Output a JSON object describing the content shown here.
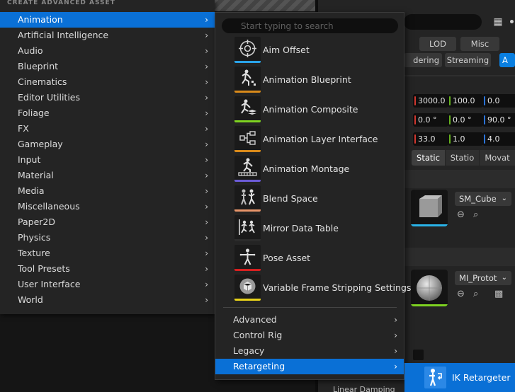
{
  "main_menu": {
    "header": "CREATE ADVANCED ASSET",
    "items": [
      {
        "label": "Animation"
      },
      {
        "label": "Artificial Intelligence"
      },
      {
        "label": "Audio"
      },
      {
        "label": "Blueprint"
      },
      {
        "label": "Cinematics"
      },
      {
        "label": "Editor Utilities"
      },
      {
        "label": "Foliage"
      },
      {
        "label": "FX"
      },
      {
        "label": "Gameplay"
      },
      {
        "label": "Input"
      },
      {
        "label": "Material"
      },
      {
        "label": "Media"
      },
      {
        "label": "Miscellaneous"
      },
      {
        "label": "Paper2D"
      },
      {
        "label": "Physics"
      },
      {
        "label": "Texture"
      },
      {
        "label": "Tool Presets"
      },
      {
        "label": "User Interface"
      },
      {
        "label": "World"
      }
    ],
    "selected": "Animation"
  },
  "animation_submenu": {
    "search_placeholder": "Start typing to search",
    "assets": [
      {
        "label": "Aim Offset",
        "icon": "aim-offset-icon",
        "color": "#2aa3e8"
      },
      {
        "label": "Animation Blueprint",
        "icon": "animation-blueprint-icon",
        "color": "#d98a1a"
      },
      {
        "label": "Animation Composite",
        "icon": "animation-composite-icon",
        "color": "#7ed321"
      },
      {
        "label": "Animation Layer Interface",
        "icon": "animation-layer-interface-icon",
        "color": "#d98a1a"
      },
      {
        "label": "Animation Montage",
        "icon": "animation-montage-icon",
        "color": "#6b5bd6"
      },
      {
        "label": "Blend Space",
        "icon": "blend-space-icon",
        "color": "#e8956a"
      },
      {
        "label": "Mirror Data Table",
        "icon": "mirror-data-table-icon",
        "color": "#2c2c2c"
      },
      {
        "label": "Pose Asset",
        "icon": "pose-asset-icon",
        "color": "#d62020"
      },
      {
        "label": "Variable Frame Stripping Settings",
        "icon": "variable-frame-stripping-icon",
        "color": "#e8d21a"
      }
    ],
    "categories": [
      {
        "label": "Advanced"
      },
      {
        "label": "Control Rig"
      },
      {
        "label": "Legacy"
      },
      {
        "label": "Retargeting"
      }
    ],
    "selected_category": "Retargeting"
  },
  "retargeting_submenu": {
    "items": [
      {
        "label": "IK Retargeter",
        "icon": "ik-retargeter-icon"
      }
    ]
  },
  "details_panel": {
    "tabs_row1": [
      "LOD",
      "Misc"
    ],
    "tabs_row2": [
      "dering",
      "Streaming",
      "A"
    ],
    "transform": {
      "location": [
        "3000.0",
        "100.0",
        "0.0"
      ],
      "rotation": [
        "0.0 °",
        "0.0 °",
        "90.0 °"
      ],
      "scale": [
        "33.0",
        "1.0",
        "4.0"
      ]
    },
    "mobility": [
      "Static",
      "Statio",
      "Movat"
    ],
    "static_mesh": "SM_Cube",
    "material": "MI_Protot",
    "footer_text": "Linear Damping"
  },
  "colors": {
    "accent": "#0a70d6",
    "menu_bg": "#242424",
    "text": "#dcdcdc"
  }
}
